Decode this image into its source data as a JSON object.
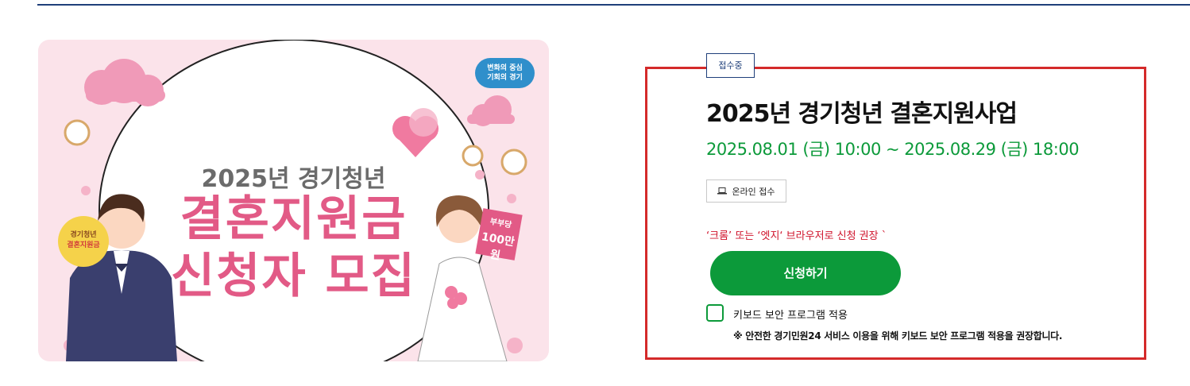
{
  "banner": {
    "slogan_line1": "변화의 중심",
    "slogan_line2": "기회의 경기",
    "subtitle": "2025년 경기청년",
    "title_line1": "결혼지원금",
    "title_line2": "신청자 모집",
    "badge_line1": "경기청년",
    "badge_line2": "결혼지원금",
    "sign_line1": "부부당",
    "sign_line2": "100만원"
  },
  "status_tag": "접수중",
  "program": {
    "title": "2025년 경기청년 결혼지원사업",
    "period": "2025.08.01 (금) 10:00 ~ 2025.08.29 (금) 18:00"
  },
  "online_tag": {
    "icon": "laptop-icon",
    "label": "온라인 접수"
  },
  "notice": "‘크롬’ 또는 ‘엣지‘ 브라우저로 신청 권장 `",
  "apply_button": "신청하기",
  "keyboard_security": {
    "label": "키보드 보안 프로그램 적용",
    "checked": false,
    "note": "※ 안전한 경기민원24 서비스 이용을 위해 키보드 보안 프로그램 적용을 권장합니다."
  },
  "colors": {
    "accent_green": "#0c9a3a",
    "highlight_red": "#d42a2a",
    "navy": "#1f3f7a",
    "banner_pink": "#e25a86"
  }
}
